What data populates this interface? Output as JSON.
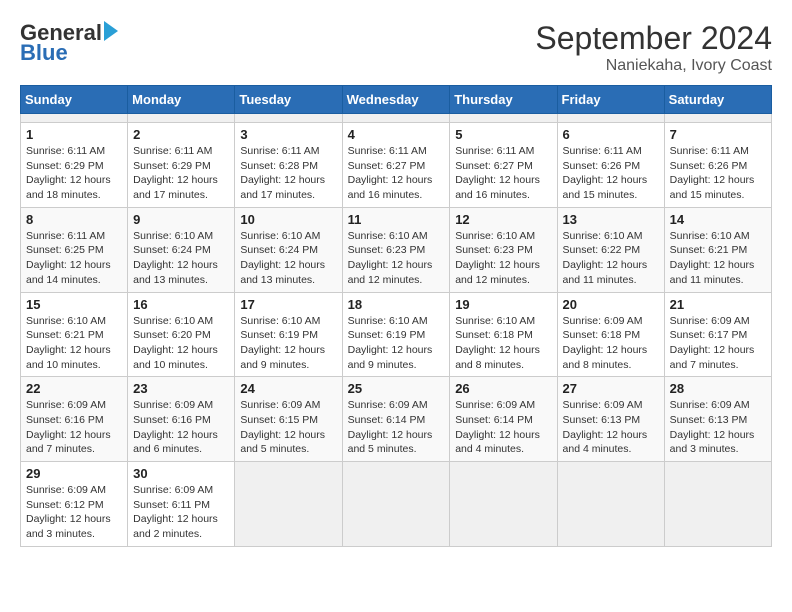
{
  "header": {
    "logo_general": "General",
    "logo_blue": "Blue",
    "title": "September 2024",
    "subtitle": "Naniekaha, Ivory Coast"
  },
  "calendar": {
    "days_of_week": [
      "Sunday",
      "Monday",
      "Tuesday",
      "Wednesday",
      "Thursday",
      "Friday",
      "Saturday"
    ],
    "weeks": [
      [
        {
          "day": "",
          "empty": true
        },
        {
          "day": "",
          "empty": true
        },
        {
          "day": "",
          "empty": true
        },
        {
          "day": "",
          "empty": true
        },
        {
          "day": "",
          "empty": true
        },
        {
          "day": "",
          "empty": true
        },
        {
          "day": "",
          "empty": true
        }
      ],
      [
        {
          "day": "1",
          "sunrise": "6:11 AM",
          "sunset": "6:29 PM",
          "daylight": "12 hours and 18 minutes."
        },
        {
          "day": "2",
          "sunrise": "6:11 AM",
          "sunset": "6:29 PM",
          "daylight": "12 hours and 17 minutes."
        },
        {
          "day": "3",
          "sunrise": "6:11 AM",
          "sunset": "6:28 PM",
          "daylight": "12 hours and 17 minutes."
        },
        {
          "day": "4",
          "sunrise": "6:11 AM",
          "sunset": "6:27 PM",
          "daylight": "12 hours and 16 minutes."
        },
        {
          "day": "5",
          "sunrise": "6:11 AM",
          "sunset": "6:27 PM",
          "daylight": "12 hours and 16 minutes."
        },
        {
          "day": "6",
          "sunrise": "6:11 AM",
          "sunset": "6:26 PM",
          "daylight": "12 hours and 15 minutes."
        },
        {
          "day": "7",
          "sunrise": "6:11 AM",
          "sunset": "6:26 PM",
          "daylight": "12 hours and 15 minutes."
        }
      ],
      [
        {
          "day": "8",
          "sunrise": "6:11 AM",
          "sunset": "6:25 PM",
          "daylight": "12 hours and 14 minutes."
        },
        {
          "day": "9",
          "sunrise": "6:10 AM",
          "sunset": "6:24 PM",
          "daylight": "12 hours and 13 minutes."
        },
        {
          "day": "10",
          "sunrise": "6:10 AM",
          "sunset": "6:24 PM",
          "daylight": "12 hours and 13 minutes."
        },
        {
          "day": "11",
          "sunrise": "6:10 AM",
          "sunset": "6:23 PM",
          "daylight": "12 hours and 12 minutes."
        },
        {
          "day": "12",
          "sunrise": "6:10 AM",
          "sunset": "6:23 PM",
          "daylight": "12 hours and 12 minutes."
        },
        {
          "day": "13",
          "sunrise": "6:10 AM",
          "sunset": "6:22 PM",
          "daylight": "12 hours and 11 minutes."
        },
        {
          "day": "14",
          "sunrise": "6:10 AM",
          "sunset": "6:21 PM",
          "daylight": "12 hours and 11 minutes."
        }
      ],
      [
        {
          "day": "15",
          "sunrise": "6:10 AM",
          "sunset": "6:21 PM",
          "daylight": "12 hours and 10 minutes."
        },
        {
          "day": "16",
          "sunrise": "6:10 AM",
          "sunset": "6:20 PM",
          "daylight": "12 hours and 10 minutes."
        },
        {
          "day": "17",
          "sunrise": "6:10 AM",
          "sunset": "6:19 PM",
          "daylight": "12 hours and 9 minutes."
        },
        {
          "day": "18",
          "sunrise": "6:10 AM",
          "sunset": "6:19 PM",
          "daylight": "12 hours and 9 minutes."
        },
        {
          "day": "19",
          "sunrise": "6:10 AM",
          "sunset": "6:18 PM",
          "daylight": "12 hours and 8 minutes."
        },
        {
          "day": "20",
          "sunrise": "6:09 AM",
          "sunset": "6:18 PM",
          "daylight": "12 hours and 8 minutes."
        },
        {
          "day": "21",
          "sunrise": "6:09 AM",
          "sunset": "6:17 PM",
          "daylight": "12 hours and 7 minutes."
        }
      ],
      [
        {
          "day": "22",
          "sunrise": "6:09 AM",
          "sunset": "6:16 PM",
          "daylight": "12 hours and 7 minutes."
        },
        {
          "day": "23",
          "sunrise": "6:09 AM",
          "sunset": "6:16 PM",
          "daylight": "12 hours and 6 minutes."
        },
        {
          "day": "24",
          "sunrise": "6:09 AM",
          "sunset": "6:15 PM",
          "daylight": "12 hours and 5 minutes."
        },
        {
          "day": "25",
          "sunrise": "6:09 AM",
          "sunset": "6:14 PM",
          "daylight": "12 hours and 5 minutes."
        },
        {
          "day": "26",
          "sunrise": "6:09 AM",
          "sunset": "6:14 PM",
          "daylight": "12 hours and 4 minutes."
        },
        {
          "day": "27",
          "sunrise": "6:09 AM",
          "sunset": "6:13 PM",
          "daylight": "12 hours and 4 minutes."
        },
        {
          "day": "28",
          "sunrise": "6:09 AM",
          "sunset": "6:13 PM",
          "daylight": "12 hours and 3 minutes."
        }
      ],
      [
        {
          "day": "29",
          "sunrise": "6:09 AM",
          "sunset": "6:12 PM",
          "daylight": "12 hours and 3 minutes."
        },
        {
          "day": "30",
          "sunrise": "6:09 AM",
          "sunset": "6:11 PM",
          "daylight": "12 hours and 2 minutes."
        },
        {
          "day": "",
          "empty": true
        },
        {
          "day": "",
          "empty": true
        },
        {
          "day": "",
          "empty": true
        },
        {
          "day": "",
          "empty": true
        },
        {
          "day": "",
          "empty": true
        }
      ]
    ]
  }
}
